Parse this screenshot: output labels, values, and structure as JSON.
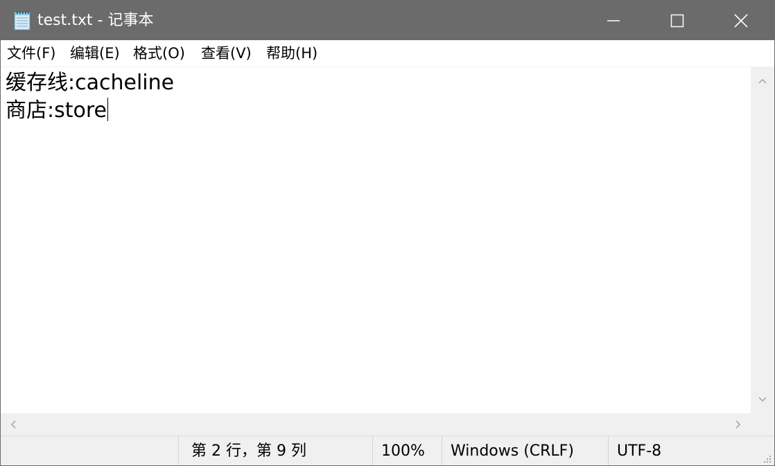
{
  "window": {
    "title": "test.txt - 记事本",
    "app_icon": "notepad-icon",
    "controls": {
      "minimize_icon": "minimize-icon",
      "maximize_icon": "maximize-icon",
      "close_icon": "close-icon"
    },
    "titlebar_color": "#6b6b6b"
  },
  "menu": {
    "file": "文件(F)",
    "edit": "编辑(E)",
    "format": "格式(O)",
    "view": "查看(V)",
    "help": "帮助(H)"
  },
  "editor": {
    "lines": [
      "缓存线:cacheline",
      "商店:store"
    ]
  },
  "scrollbars": {
    "up_icon": "chevron-up-icon",
    "down_icon": "chevron-down-icon",
    "left_icon": "chevron-left-icon",
    "right_icon": "chevron-right-icon"
  },
  "status": {
    "position": "第 2 行，第 9 列",
    "zoom": "100%",
    "line_ending": "Windows (CRLF)",
    "encoding": "UTF-8"
  }
}
